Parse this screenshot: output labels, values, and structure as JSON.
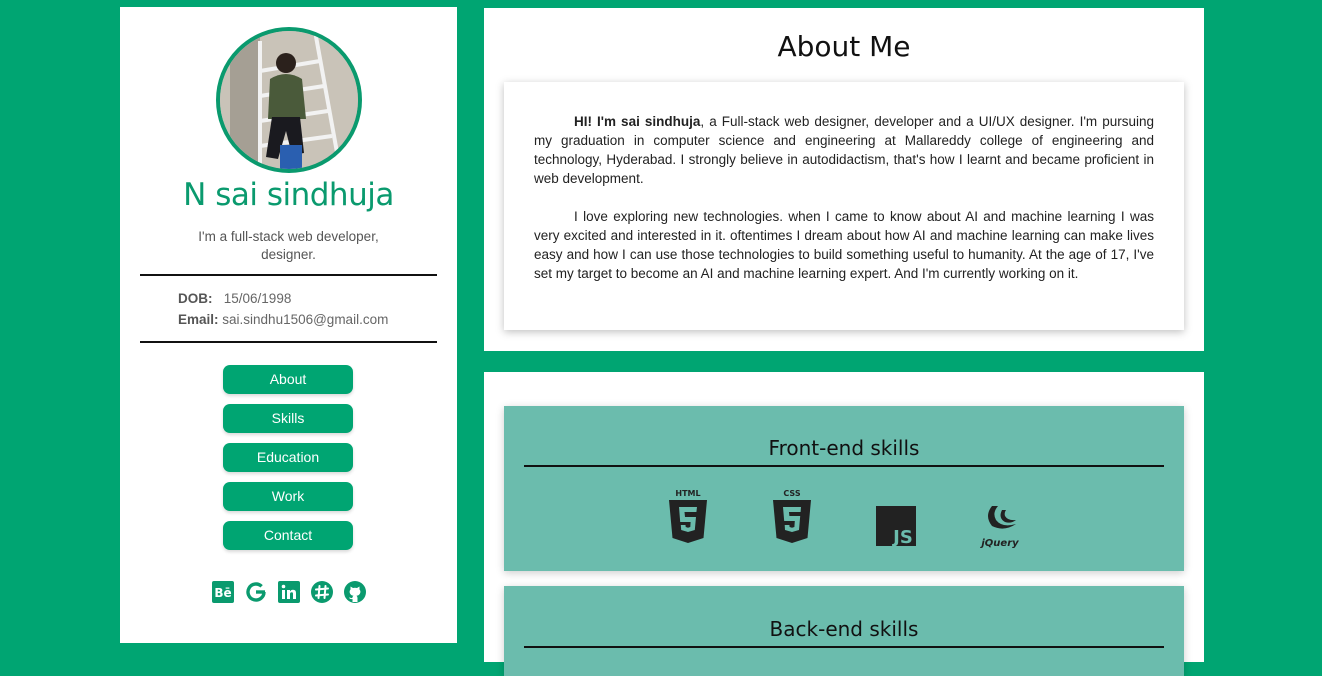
{
  "profile": {
    "name": "N sai sindhuja",
    "tagline": "I'm a full-stack web developer, designer.",
    "dob_label": "DOB:",
    "dob_value": "15/06/1998",
    "email_label": "Email:",
    "email_value": "sai.sindhu1506@gmail.com"
  },
  "nav": {
    "items": [
      {
        "label": "About"
      },
      {
        "label": "Skills"
      },
      {
        "label": "Education"
      },
      {
        "label": "Work"
      },
      {
        "label": "Contact"
      }
    ]
  },
  "social": [
    "behance-icon",
    "google-icon",
    "linkedin-icon",
    "slack-icon",
    "github-icon"
  ],
  "about": {
    "title": "About Me",
    "intro_bold": "HI! I'm sai sindhuja",
    "para1_rest": ", a Full-stack web designer, developer and a UI/UX designer. I'm pursuing my graduation in computer science and engineering at Mallareddy college of engineering and technology, Hyderabad. I strongly believe in autodidactism, that's how I learnt and became proficient in web development.",
    "para2": "I love exploring new technologies. when I came to know about AI and machine learning I was very excited and interested in it. oftentimes I dream about how AI and machine learning can make lives easy and how I can use those technologies to build something useful to humanity. At the age of 17, I've set my target to become an AI and machine learning expert. And I'm currently working on it."
  },
  "skills": {
    "frontend_title": "Front-end skills",
    "frontend_icons": [
      {
        "name": "html5-icon",
        "label": "HTML"
      },
      {
        "name": "css3-icon",
        "label": "CSS"
      },
      {
        "name": "javascript-icon",
        "label": "JS"
      },
      {
        "name": "jquery-icon",
        "label": "jQuery"
      }
    ],
    "backend_title": "Back-end skills"
  },
  "colors": {
    "accent": "#00a572",
    "skill_bg": "#6bbcad"
  }
}
